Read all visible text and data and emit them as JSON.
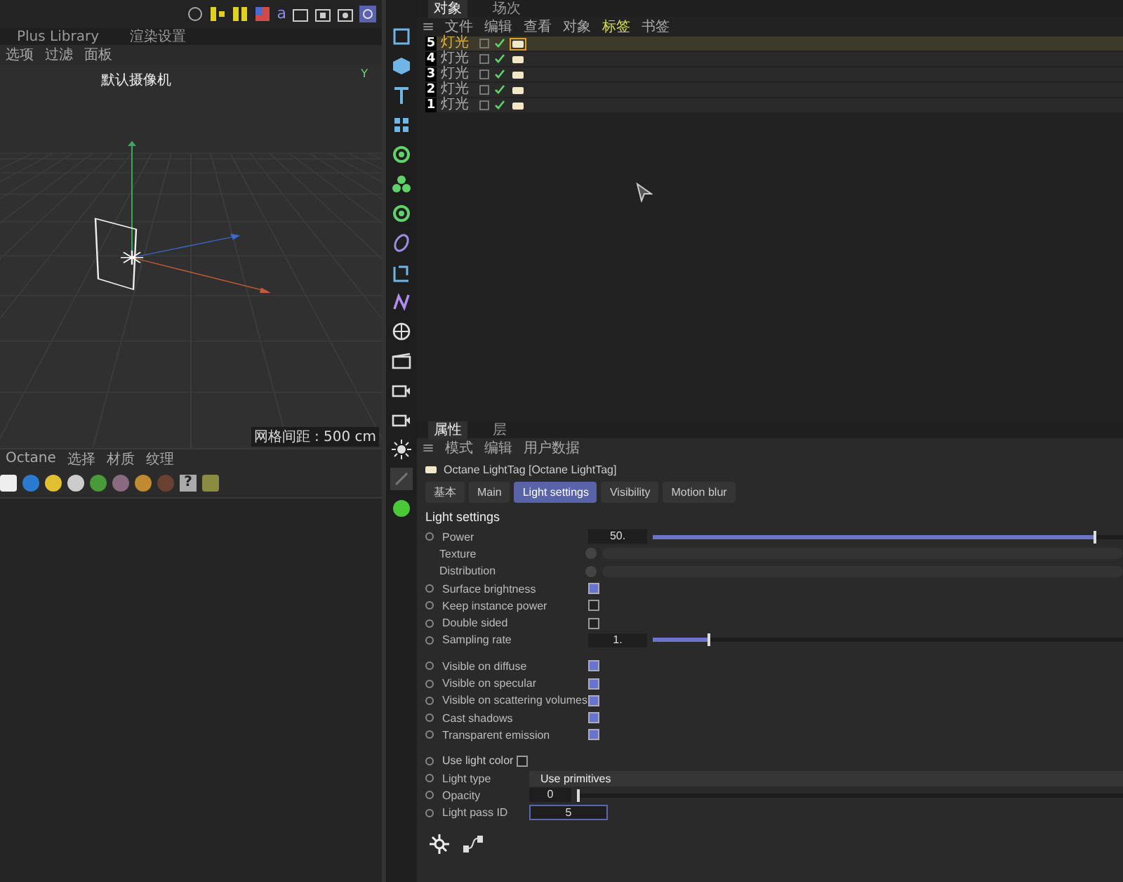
{
  "top_toolbar": {
    "glyph": "a"
  },
  "left_tabs": [
    {
      "label": "Plus Library",
      "selected": false
    },
    {
      "label": "渲染设置",
      "selected": false
    }
  ],
  "viewport_menu": [
    "选项",
    "过滤",
    "面板"
  ],
  "viewport": {
    "camera": "默认摄像机",
    "axis_label": "Y",
    "grid_spacing": "网格间距 : 500 cm"
  },
  "material_menu": [
    "Octane",
    "选择",
    "材质",
    "纹理"
  ],
  "material_icons": {
    "help_glyph": "?"
  },
  "object_tabs": [
    {
      "label": "对象",
      "selected": true
    },
    {
      "label": "场次",
      "selected": false
    }
  ],
  "object_menu": [
    {
      "label": "文件",
      "active": false
    },
    {
      "label": "编辑",
      "active": false
    },
    {
      "label": "查看",
      "active": false
    },
    {
      "label": "对象",
      "active": false
    },
    {
      "label": "标签",
      "active": true
    },
    {
      "label": "书签",
      "active": false
    }
  ],
  "objects": [
    {
      "index": "5",
      "name": "灯光",
      "selected": true,
      "enabled": true
    },
    {
      "index": "4",
      "name": "灯光",
      "selected": false,
      "enabled": true
    },
    {
      "index": "3",
      "name": "灯光",
      "selected": false,
      "enabled": true
    },
    {
      "index": "2",
      "name": "灯光",
      "selected": false,
      "enabled": true
    },
    {
      "index": "1",
      "name": "灯光",
      "selected": false,
      "enabled": true
    }
  ],
  "attr_tabs": [
    {
      "label": "属性",
      "selected": true
    },
    {
      "label": "层",
      "selected": false
    }
  ],
  "attr_menu": [
    "模式",
    "编辑",
    "用户数据"
  ],
  "tag_title": "Octane LightTag [Octane LightTag]",
  "param_tabs": [
    {
      "label": "基本",
      "selected": false
    },
    {
      "label": "Main",
      "selected": false
    },
    {
      "label": "Light settings",
      "selected": true
    },
    {
      "label": "Visibility",
      "selected": false
    },
    {
      "label": "Motion blur",
      "selected": false
    }
  ],
  "section_title": "Light settings",
  "groups": [
    [
      {
        "kind": "slider",
        "label": "Power",
        "value": "50.",
        "level": 0.94
      },
      {
        "kind": "link",
        "label": "Texture"
      },
      {
        "kind": "link",
        "label": "Distribution"
      },
      {
        "kind": "checkbox",
        "label": "Surface brightness",
        "checked": true
      },
      {
        "kind": "checkbox",
        "label": "Keep instance power",
        "checked": false
      },
      {
        "kind": "checkbox",
        "label": "Double sided",
        "checked": false
      },
      {
        "kind": "slider",
        "label": "Sampling rate",
        "value": "1.",
        "level": 0.12
      }
    ],
    [
      {
        "kind": "checkbox",
        "label": "Visible on diffuse",
        "checked": true
      },
      {
        "kind": "checkbox",
        "label": "Visible on specular",
        "checked": true
      },
      {
        "kind": "checkbox",
        "label": "Visible on scattering volumes",
        "checked": true
      },
      {
        "kind": "checkbox",
        "label": "Cast shadows",
        "checked": true
      },
      {
        "kind": "checkbox",
        "label": "Transparent emission",
        "checked": true
      }
    ],
    [
      {
        "kind": "inline-checkbox",
        "label": "Use light color",
        "checked": false
      },
      {
        "kind": "dropdown",
        "label": "Light type",
        "value": "Use primitives"
      },
      {
        "kind": "short-slider",
        "label": "Opacity",
        "value": "0",
        "level": 0
      },
      {
        "kind": "field",
        "label": "Light pass ID",
        "value": "5"
      }
    ]
  ]
}
